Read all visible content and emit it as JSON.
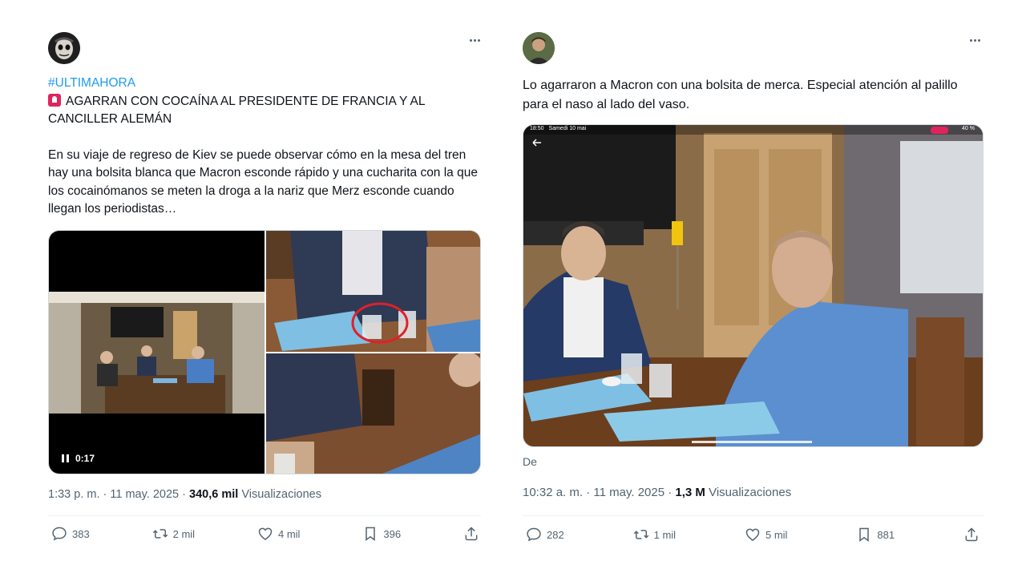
{
  "left": {
    "hashtag": "#ULTIMAHORA",
    "headline": "AGARRAN CON COCAÍNA AL PRESIDENTE DE FRANCIA Y AL CANCILLER ALEMÁN",
    "body": "En su viaje de regreso de Kiev se puede observar cómo en la mesa del tren hay una bolsita blanca que Macron esconde rápido y una cucharita con la que los cocainómanos se meten la droga a la nariz que Merz esconde cuando llegan los periodistas…",
    "video_time": "0:17",
    "time": "1:33 p. m.",
    "date": "11 may. 2025",
    "views_count": "340,6 mil",
    "views_label": "Visualizaciones",
    "actions": {
      "replies": "383",
      "reposts": "2 mil",
      "likes": "4 mil",
      "bookmarks": "396"
    }
  },
  "right": {
    "body": "Lo agarraron a Macron con una bolsita de merca. Especial atención al palillo para el naso al lado del vaso.",
    "screen_status_time": "18:50",
    "screen_status_date": "Samedi 10 mai",
    "screen_status_battery": "40 %",
    "caption": "De",
    "time": "10:32 a. m.",
    "date": "11 may. 2025",
    "views_count": "1,3 M",
    "views_label": "Visualizaciones",
    "actions": {
      "replies": "282",
      "reposts": "1 mil",
      "likes": "5 mil",
      "bookmarks": "881"
    }
  },
  "separator": "·",
  "icons": {
    "reply": "reply-icon",
    "repost": "repost-icon",
    "like": "heart-icon",
    "bookmark": "bookmark-icon",
    "share": "share-icon",
    "more": "more-icon",
    "siren": "siren-emoji-icon"
  },
  "colors": {
    "link": "#1d9bf0",
    "text": "#0f1419",
    "muted": "#536471",
    "border": "#cfd9de"
  }
}
